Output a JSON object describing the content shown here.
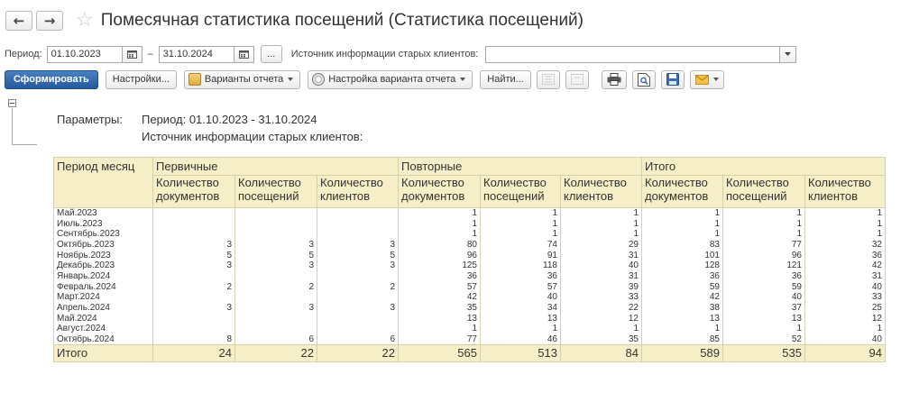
{
  "window": {
    "title": "Помесячная статистика посещений (Статистика посещений)",
    "back_glyph": "←",
    "forward_glyph": "→",
    "favorite_glyph": "☆"
  },
  "params_bar": {
    "period_label": "Период:",
    "date_from": "01.10.2023",
    "dash": "–",
    "date_to": "31.10.2024",
    "ellipsis": "...",
    "source_label": "Источник информации старых клиентов:",
    "source_value": ""
  },
  "toolbar": {
    "generate": "Сформировать",
    "settings": "Настройки...",
    "variants": "Варианты отчета",
    "variant_settings": "Настройка варианта отчета",
    "find": "Найти..."
  },
  "report": {
    "params_caption": "Параметры:",
    "params_period": "Период: 01.10.2023 - 31.10.2024",
    "params_source": "Источник информации старых клиентов:",
    "header": {
      "period_col": "Период месяц",
      "groups": [
        "Первичные",
        "Повторные",
        "Итого"
      ],
      "subcols": [
        "Количество документов",
        "Количество посещений",
        "Количество клиентов"
      ]
    },
    "rows": [
      {
        "period": "Май.2023",
        "values": [
          "",
          "",
          "",
          "1",
          "1",
          "1",
          "1",
          "1",
          "1"
        ]
      },
      {
        "period": "Июль.2023",
        "values": [
          "",
          "",
          "",
          "1",
          "1",
          "1",
          "1",
          "1",
          "1"
        ]
      },
      {
        "period": "Сентябрь.2023",
        "values": [
          "",
          "",
          "",
          "1",
          "1",
          "1",
          "1",
          "1",
          "1"
        ]
      },
      {
        "period": "Октябрь.2023",
        "values": [
          "3",
          "3",
          "3",
          "80",
          "74",
          "29",
          "83",
          "77",
          "32"
        ]
      },
      {
        "period": "Ноябрь.2023",
        "values": [
          "5",
          "5",
          "5",
          "96",
          "91",
          "31",
          "101",
          "96",
          "36"
        ]
      },
      {
        "period": "Декабрь.2023",
        "values": [
          "3",
          "3",
          "3",
          "125",
          "118",
          "40",
          "128",
          "121",
          "42"
        ]
      },
      {
        "period": "Январь.2024",
        "values": [
          "",
          "",
          "",
          "36",
          "36",
          "31",
          "36",
          "36",
          "31"
        ]
      },
      {
        "period": "Февраль.2024",
        "values": [
          "2",
          "2",
          "2",
          "57",
          "57",
          "39",
          "59",
          "59",
          "40"
        ]
      },
      {
        "period": "Март.2024",
        "values": [
          "",
          "",
          "",
          "42",
          "40",
          "33",
          "42",
          "40",
          "33"
        ]
      },
      {
        "period": "Апрель.2024",
        "values": [
          "3",
          "3",
          "3",
          "35",
          "34",
          "22",
          "38",
          "37",
          "25"
        ]
      },
      {
        "period": "Май.2024",
        "values": [
          "",
          "",
          "",
          "13",
          "13",
          "12",
          "13",
          "13",
          "12"
        ]
      },
      {
        "period": "Август.2024",
        "values": [
          "",
          "",
          "",
          "1",
          "1",
          "1",
          "1",
          "1",
          "1"
        ]
      },
      {
        "period": "Октябрь.2024",
        "values": [
          "8",
          "6",
          "6",
          "77",
          "46",
          "35",
          "85",
          "52",
          "40"
        ]
      }
    ],
    "total": {
      "label": "Итого",
      "values": [
        "24",
        "22",
        "22",
        "565",
        "513",
        "84",
        "589",
        "535",
        "94"
      ]
    }
  }
}
